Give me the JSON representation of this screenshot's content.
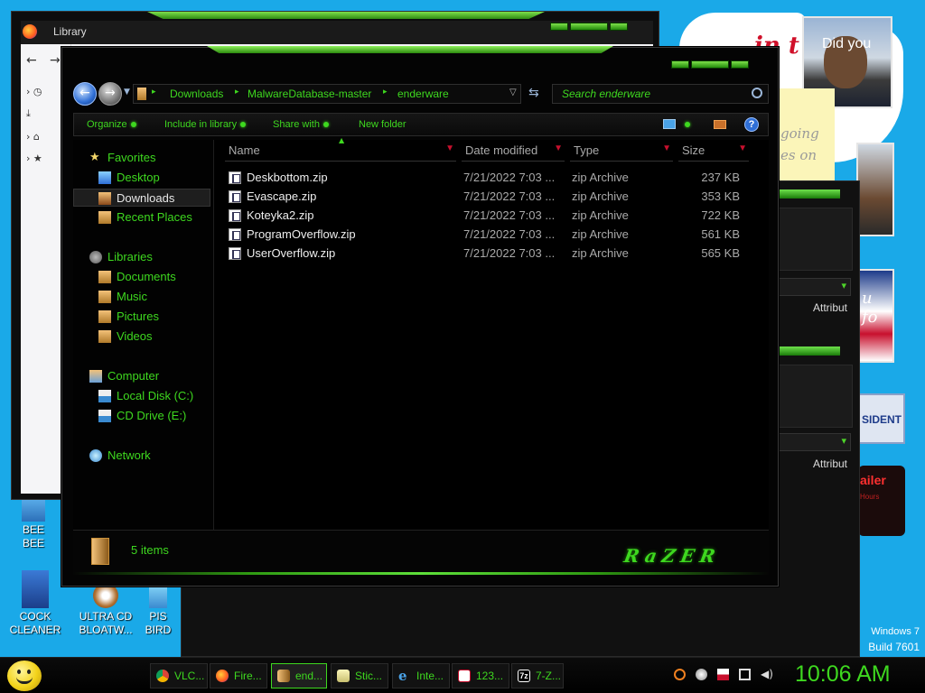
{
  "desktop": {
    "icons": [
      {
        "label1": "BEE",
        "label2": "BEE"
      },
      {
        "label1": "COCK",
        "label2": "CLEANER"
      },
      {
        "label1": "ULTRA CD",
        "label2": "BLOATW..."
      },
      {
        "label1": "PIS",
        "label2": "BIRD"
      }
    ],
    "note_text": "in t",
    "obama_caption": "Did you",
    "sticky_lines": [
      "going",
      "es on"
    ],
    "flag_text": "u fo",
    "president_text": "SIDENT",
    "trailer_text": "ailer",
    "trailer_sub": "Hours",
    "os_name": "Windows 7",
    "build": "Build 7601"
  },
  "firefox_window": {
    "title": "Library"
  },
  "background_windows": {
    "attrib_1": "Attribut",
    "attrib_2": "Attribut"
  },
  "explorer": {
    "breadcrumbs": [
      "Downloads",
      "MalwareDatabase-master",
      "enderware"
    ],
    "search_placeholder": "Search enderware",
    "commands": {
      "organize": "Organize",
      "include": "Include in library",
      "share": "Share with",
      "new_folder": "New folder"
    },
    "nav": {
      "favorites": "Favorites",
      "desktop": "Desktop",
      "downloads": "Downloads",
      "recent": "Recent Places",
      "libraries": "Libraries",
      "documents": "Documents",
      "music": "Music",
      "pictures": "Pictures",
      "videos": "Videos",
      "computer": "Computer",
      "local_disk": "Local Disk (C:)",
      "cd_drive": "CD Drive (E:)",
      "network": "Network"
    },
    "columns": {
      "name": "Name",
      "date": "Date modified",
      "type": "Type",
      "size": "Size"
    },
    "files": [
      {
        "name": "Deskbottom.zip",
        "date": "7/21/2022 7:03 ...",
        "type": "zip Archive",
        "size": "237 KB"
      },
      {
        "name": "Evascape.zip",
        "date": "7/21/2022 7:03 ...",
        "type": "zip Archive",
        "size": "353 KB"
      },
      {
        "name": "Koteyka2.zip",
        "date": "7/21/2022 7:03 ...",
        "type": "zip Archive",
        "size": "722 KB"
      },
      {
        "name": "ProgramOverflow.zip",
        "date": "7/21/2022 7:03 ...",
        "type": "zip Archive",
        "size": "561 KB"
      },
      {
        "name": "UserOverflow.zip",
        "date": "7/21/2022 7:03 ...",
        "type": "zip Archive",
        "size": "565 KB"
      }
    ],
    "status": "5 items",
    "brand": "RaZER"
  },
  "taskbar": {
    "buttons": [
      {
        "label": "VLC...",
        "icon": "chrome-icon"
      },
      {
        "label": "Fire...",
        "icon": "firefox-icon"
      },
      {
        "label": "end...",
        "icon": "folder-icon"
      },
      {
        "label": "Stic...",
        "icon": "sticky-notes-icon"
      },
      {
        "label": "Inte...",
        "icon": "ie-icon"
      },
      {
        "label": "123...",
        "icon": "cards-icon"
      },
      {
        "label": "7-Z...",
        "icon": "7zip-icon"
      }
    ],
    "clock": "10:06 AM"
  },
  "colors": {
    "accent_green": "#3ed81f",
    "window_bg": "#040404",
    "desktop_bg": "#1aa9e8"
  }
}
